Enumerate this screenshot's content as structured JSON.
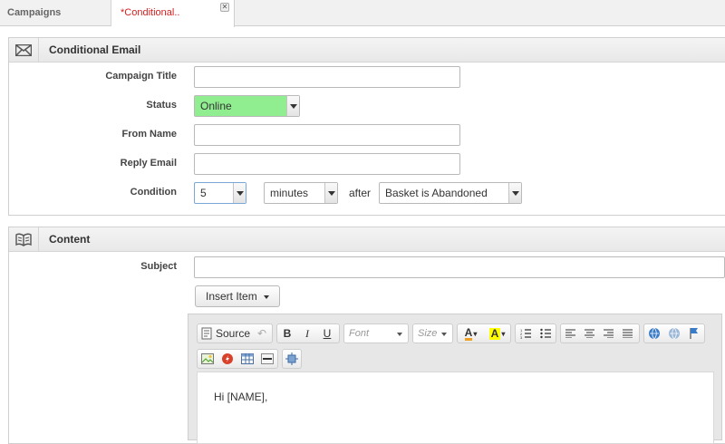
{
  "tabs": [
    {
      "label": "Campaigns"
    },
    {
      "label": "*Conditional.."
    }
  ],
  "email_panel": {
    "title": "Conditional Email",
    "icon": "envelope-icon",
    "fields": {
      "campaign_title": {
        "label": "Campaign Title",
        "value": ""
      },
      "status": {
        "label": "Status",
        "value": "Online",
        "color": "#90ee90"
      },
      "from_name": {
        "label": "From Name",
        "value": ""
      },
      "reply_email": {
        "label": "Reply Email",
        "value": ""
      },
      "condition": {
        "label": "Condition",
        "amount": "5",
        "unit": "minutes",
        "after_text": "after",
        "trigger": "Basket is Abandoned"
      }
    }
  },
  "content_panel": {
    "title": "Content",
    "icon": "book-icon",
    "subject": {
      "label": "Subject",
      "value": ""
    },
    "insert_item_label": "Insert Item",
    "editor": {
      "source_label": "Source",
      "font_placeholder": "Font",
      "size_placeholder": "Size",
      "body_text": "Hi [NAME],"
    }
  }
}
